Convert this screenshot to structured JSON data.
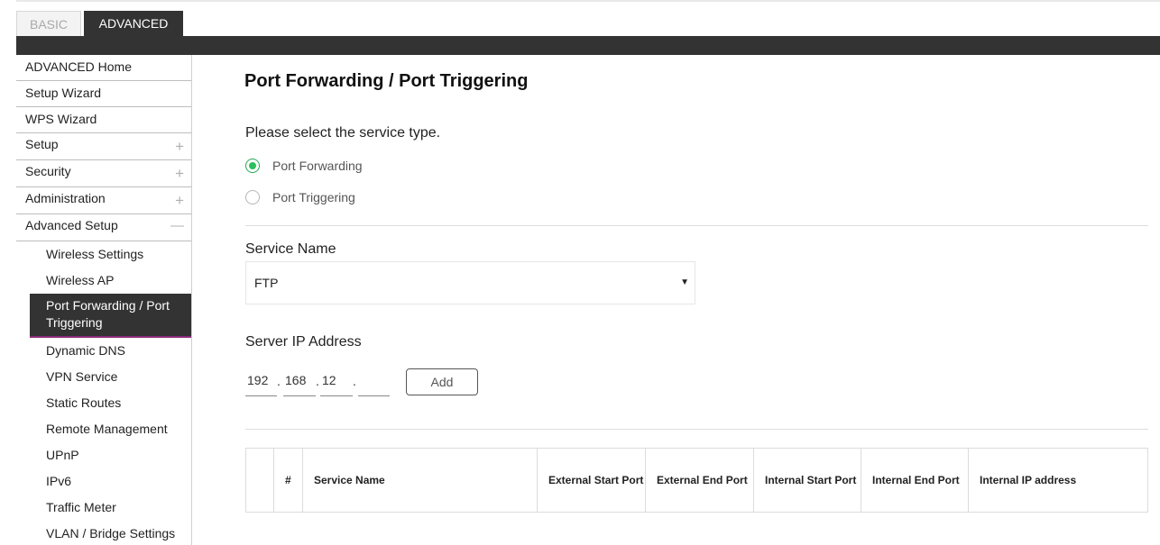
{
  "tabs": {
    "basic": "BASIC",
    "advanced": "ADVANCED"
  },
  "sidebar": {
    "items": [
      {
        "label": "ADVANCED Home"
      },
      {
        "label": "Setup Wizard"
      },
      {
        "label": "WPS Wizard"
      },
      {
        "label": "Setup",
        "toggle": "+"
      },
      {
        "label": "Security",
        "toggle": "+"
      },
      {
        "label": "Administration",
        "toggle": "+"
      },
      {
        "label": "Advanced Setup",
        "toggle": "—"
      }
    ],
    "subitems": [
      {
        "label": "Wireless Settings"
      },
      {
        "label": "Wireless AP"
      },
      {
        "label": "Port Forwarding / Port Triggering"
      },
      {
        "label": "Dynamic DNS"
      },
      {
        "label": "VPN Service"
      },
      {
        "label": "Static Routes"
      },
      {
        "label": "Remote Management"
      },
      {
        "label": "UPnP"
      },
      {
        "label": "IPv6"
      },
      {
        "label": "Traffic Meter"
      },
      {
        "label": "VLAN / Bridge Settings"
      }
    ],
    "active_subitem": "Port Forwarding / Port Triggering"
  },
  "main": {
    "title": "Port Forwarding / Port Triggering",
    "prompt": "Please select the service type.",
    "service_types": [
      {
        "label": "Port Forwarding",
        "checked": true
      },
      {
        "label": "Port Triggering",
        "checked": false
      }
    ],
    "service_name_label": "Service Name",
    "service_name_value": "FTP",
    "server_ip_label": "Server IP Address",
    "server_ip": [
      "192",
      "168",
      "12",
      ""
    ],
    "ip_separator": ".",
    "add_button": "Add",
    "table_headers": [
      "",
      "#",
      "Service Name",
      "External Start Port",
      "External End Port",
      "Internal Start Port",
      "Internal End Port",
      "Internal IP address"
    ]
  },
  "colors": {
    "accent_green": "#2bbf5e",
    "header_dark": "#333333",
    "active_underline": "#8a2a7a"
  },
  "icons": {
    "expand": "plus-icon",
    "collapse": "minus-icon",
    "dropdown": "caret-down-icon"
  }
}
